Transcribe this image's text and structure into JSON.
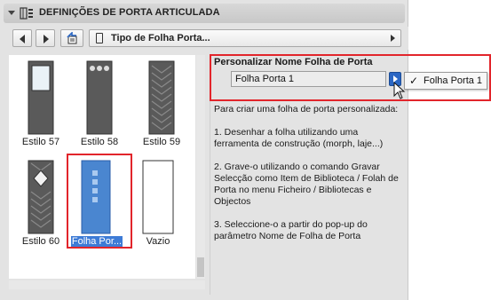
{
  "header": {
    "title": "DEFINIÇÕES DE PORTA ARTICULADA"
  },
  "toolbar": {
    "page_selector": "Tipo de Folha Porta..."
  },
  "styles": [
    {
      "label": "Estilo 57",
      "kind": "window-door"
    },
    {
      "label": "Estilo 58",
      "kind": "three-dots-door"
    },
    {
      "label": "Estilo 59",
      "kind": "chevron-door"
    },
    {
      "label": "Estilo 60",
      "kind": "diamond-door"
    },
    {
      "label": "Folha Por...",
      "kind": "custom-door",
      "selected": true
    },
    {
      "label": "Vazio",
      "kind": "empty-door"
    }
  ],
  "custom": {
    "title": "Personalizar Nome Folha de Porta",
    "field_value": "Folha Porta 1",
    "dropdown_item": "Folha Porta 1",
    "dropdown_checked": true
  },
  "instructions": {
    "intro": "Para criar uma folha de porta personalizada:",
    "step1": "1. Desenhar a folha utilizando uma ferramenta de construção (morph, laje...)",
    "step2": "2. Grave-o utilizando o comando Gravar Selecção como Item de Biblioteca / Folah de Porta no menu Ficheiro / Bibliotecas e Objectos",
    "step3": "3. Seleccione-o a partir do pop-up do parâmetro Nome de Folha de Porta"
  },
  "colors": {
    "selection": "#3d7bd6",
    "highlight": "#e2252b",
    "door_dark": "#5a5a5a",
    "door_custom": "#4a86d0"
  }
}
